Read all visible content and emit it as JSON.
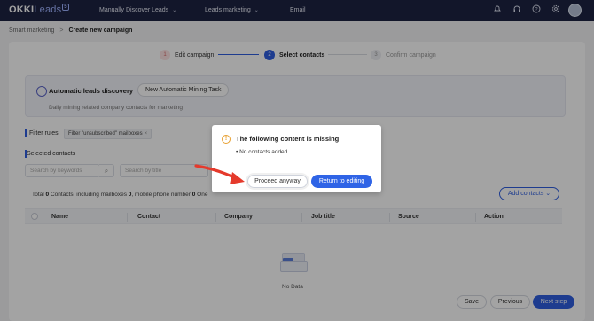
{
  "topnav": {
    "logo_main": "OKKI",
    "logo_sub": "Leads",
    "logo_badge": "5",
    "items": [
      {
        "label": "Manually Discover Leads",
        "chevron": true
      },
      {
        "label": "Leads marketing",
        "chevron": true
      },
      {
        "label": "Email",
        "chevron": false
      }
    ],
    "icons": [
      "bell-icon",
      "headset-icon",
      "help-icon",
      "gear-icon",
      "avatar"
    ]
  },
  "breadcrumb": {
    "root": "Smart marketing",
    "separator": ">",
    "current": "Create new campaign"
  },
  "steps": [
    {
      "num": "1",
      "label": "Edit campaign",
      "state": "done"
    },
    {
      "num": "2",
      "label": "Select contacts",
      "state": "active"
    },
    {
      "num": "3",
      "label": "Confirm campaign",
      "state": "pending"
    }
  ],
  "discovery": {
    "title": "Automatic leads discovery",
    "button": "New Automatic Mining Task",
    "subtitle": "Daily mining related company contacts for marketing"
  },
  "filters": {
    "label": "Filter rules",
    "chip": "Filter \"unsubscribed\" mailboxes",
    "chip_close": "×"
  },
  "selected": {
    "label": "Selected contacts",
    "search_keywords_placeholder": "Search by keywords",
    "search_title_placeholder": "Search by title"
  },
  "totals": {
    "prefix": "Total",
    "contacts": "0",
    "mid": "Contacts, including mailboxes",
    "mailboxes": "0",
    "mid2": ", mobile phone number",
    "phones": "0",
    "suffix": "One"
  },
  "add_contacts": "Add contacts",
  "table": {
    "columns": [
      "Name",
      "Contact",
      "Company",
      "Job title",
      "Source",
      "Action"
    ]
  },
  "empty": {
    "text": "No Data"
  },
  "footer": {
    "save": "Save",
    "previous": "Previous",
    "next": "Next step"
  },
  "dialog": {
    "title": "The following content is missing",
    "bullet": "• No contacts added",
    "proceed": "Proceed anyway",
    "return": "Return to editing"
  },
  "colors": {
    "nav_bg": "#1d2342",
    "primary": "#2f5fe0",
    "warning": "#e8a030",
    "arrow": "#e53a2c"
  }
}
